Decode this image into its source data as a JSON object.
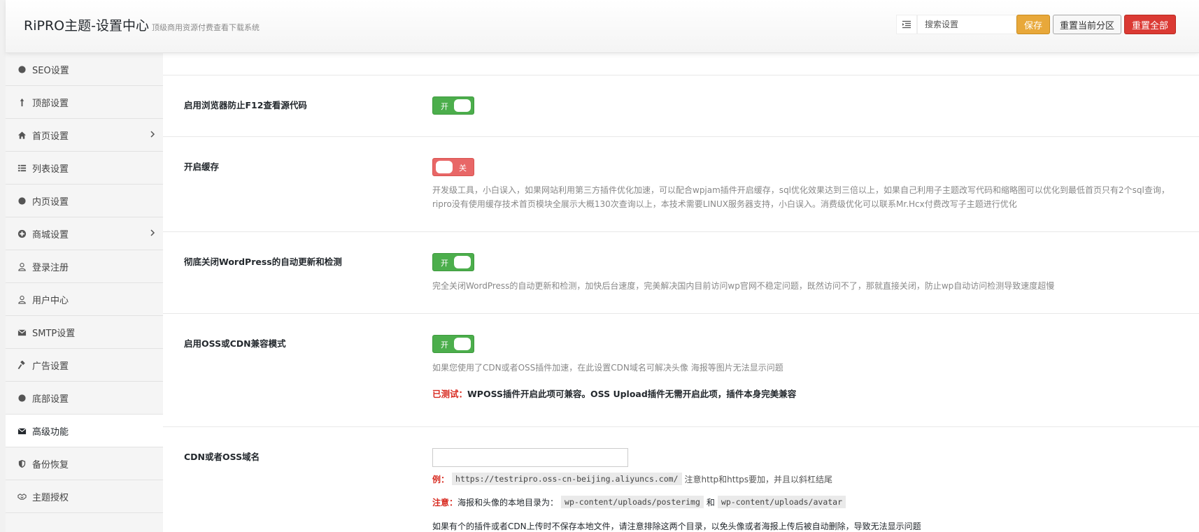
{
  "header": {
    "title": "RiPRO主题-设置中心",
    "subtitle": "顶级商用资源付费查看下载系统",
    "search_placeholder": "搜索设置",
    "save_label": "保存",
    "reset_section_label": "重置当前分区",
    "reset_all_label": "重置全部"
  },
  "sidebar": {
    "items": [
      {
        "label": "SEO设置",
        "icon": "circle-icon"
      },
      {
        "label": "顶部设置",
        "icon": "arrow-up-icon"
      },
      {
        "label": "首页设置",
        "icon": "home-icon",
        "has_children": true
      },
      {
        "label": "列表设置",
        "icon": "list-icon"
      },
      {
        "label": "内页设置",
        "icon": "circle-icon"
      },
      {
        "label": "商城设置",
        "icon": "plus-circle-icon",
        "has_children": true
      },
      {
        "label": "登录注册",
        "icon": "user-icon"
      },
      {
        "label": "用户中心",
        "icon": "user-icon"
      },
      {
        "label": "SMTP设置",
        "icon": "envelope-icon"
      },
      {
        "label": "广告设置",
        "icon": "gavel-icon"
      },
      {
        "label": "底部设置",
        "icon": "circle-icon"
      },
      {
        "label": "高级功能",
        "icon": "envelope-icon",
        "active": true
      },
      {
        "label": "备份恢复",
        "icon": "shield-icon"
      },
      {
        "label": "主题授权",
        "icon": "handshake-icon"
      }
    ]
  },
  "main": {
    "options": {
      "f12": {
        "label": "启用浏览器防止F12查看源代码",
        "toggle_text": "开",
        "enabled": true
      },
      "cache": {
        "label": "开启缓存",
        "toggle_text": "关",
        "enabled": false,
        "desc": "开发级工具，小白误入，如果网站利用第三方插件优化加速，可以配合wpjam插件开启缓存，sql优化效果达到三倍以上，如果自己利用子主题改写代码和缩略图可以优化到最低首页只有2个sql查询，ripro没有使用缓存技术首页模块全展示大概130次查询以上，本技术需要LINUX服务器支持，小白误入。消费级优化可以联系Mr.Hcx付费改写子主题进行优化"
      },
      "wp_update": {
        "label": "彻底关闭WordPress的自动更新和检测",
        "toggle_text": "开",
        "enabled": true,
        "desc": "完全关闭WordPress的自动更新和检测，加快后台速度，完美解决国内目前访问wp官网不稳定问题，既然访问不了，那就直接关闭，防止wp自动访问检测导致速度超慢"
      },
      "oss": {
        "label": "启用OSS或CDN兼容模式",
        "toggle_text": "开",
        "enabled": true,
        "desc": "如果您使用了CDN或者OSS插件加速，在此设置CDN域名可解决头像 海报等图片无法显示问题",
        "tested_prefix": "已测试：",
        "tested_text": "WPOSS插件开启此项可兼容。OSS Upload插件无需开启此项，插件本身完美兼容"
      },
      "cdn_domain": {
        "label": "CDN或者OSS域名",
        "value": "",
        "example_prefix": "例：",
        "example_code": "https://testripro.oss-cn-beijing.aliyuncs.com/",
        "example_note": "注意http和https要加，并且以斜杠结尾",
        "warn_prefix": "注意：",
        "warn_text": "海报和头像的本地目录为：",
        "path1": "wp-content/uploads/posterimg",
        "and": "和",
        "path2": "wp-content/uploads/avatar",
        "tail": "如果有个的插件或者CDN上传时不保存本地文件，请注意排除这两个目录，以免头像或者海报上传后被自动删除，导致无法显示问题"
      }
    }
  }
}
